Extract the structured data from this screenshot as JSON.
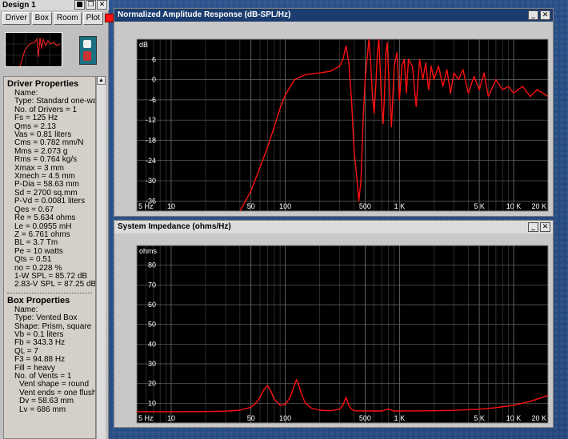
{
  "designer": {
    "title": "Design 1",
    "nav_buttons": [
      "Driver",
      "Box",
      "Room",
      "Plot"
    ],
    "window_controls": [
      "■",
      "❐",
      "✕"
    ]
  },
  "driver_properties": {
    "heading": "Driver Properties",
    "lines": [
      "Name:",
      "Type: Standard one-way c",
      "No. of Drivers = 1",
      "Fs = 125 Hz",
      "Qms = 2.13",
      "Vas = 0.81 liters",
      "Cms = 0.782 mm/N",
      "Mms = 2.073 g",
      "Rms = 0.764 kg/s",
      "Xmax = 3 mm",
      "Xmech = 4.5 mm",
      "P-Dia = 58.63 mm",
      "Sd = 2700 sq.mm",
      "P-Vd = 0.0081 liters",
      "Qes = 0.67",
      "Re = 5.634 ohms",
      "Le = 0.0955 mH",
      "Z = 6.761 ohms",
      "BL = 3.7 Tm",
      "Pe = 10 watts",
      "Qts = 0.51",
      "no = 0.228 %",
      "1-W SPL = 85.72 dB",
      "2.83-V SPL = 87.25 dB"
    ]
  },
  "box_properties": {
    "heading": "Box Properties",
    "lines": [
      "Name:",
      "Type: Vented Box",
      "Shape: Prism, square",
      "Vb = 0.1 liters",
      "Fb = 343.3 Hz",
      "QL = 7",
      "F3 = 94.88 Hz",
      "Fill = heavy",
      "No. of Vents = 1"
    ],
    "vent_lines": [
      "Vent shape = round",
      "Vent ends = one flush"
    ],
    "dim_lines": [
      "Dv = 58.63 mm",
      "Lv = 686 mm"
    ]
  },
  "amplitude_window": {
    "title": "Normalized Amplitude Response (dB-SPL/Hz)",
    "controls": [
      "_",
      "✕"
    ]
  },
  "impedance_window": {
    "title": "System Impedance (ohms/Hz)",
    "controls": [
      "_",
      "✕"
    ]
  },
  "chart_data": [
    {
      "type": "line",
      "title": "Normalized Amplitude Response (dB-SPL/Hz)",
      "xscale": "log",
      "xlim": [
        5,
        20000
      ],
      "ylim": [
        -39,
        12
      ],
      "yunit": "dB",
      "x_ticks": [
        {
          "value": 5,
          "label": "5 Hz"
        },
        {
          "value": 10,
          "label": "10"
        },
        {
          "value": 50,
          "label": "50"
        },
        {
          "value": 100,
          "label": "100"
        },
        {
          "value": 500,
          "label": "500"
        },
        {
          "value": 1000,
          "label": "1 K"
        },
        {
          "value": 5000,
          "label": "5 K"
        },
        {
          "value": 10000,
          "label": "10 K"
        },
        {
          "value": 20000,
          "label": "20 K"
        }
      ],
      "y_ticks": [
        6,
        0,
        -6,
        -12,
        -18,
        -24,
        -30,
        -36
      ],
      "grid": true,
      "series": [
        {
          "color": "#ff1010",
          "x": [
            40,
            50,
            60,
            70,
            80,
            90,
            100,
            120,
            150,
            200,
            250,
            300,
            320,
            340,
            360,
            380,
            400,
            420,
            440,
            460,
            480,
            500,
            520,
            540,
            560,
            580,
            600,
            620,
            640,
            660,
            680,
            700,
            720,
            740,
            760,
            780,
            800,
            850,
            900,
            950,
            1000,
            1050,
            1100,
            1150,
            1200,
            1300,
            1400,
            1500,
            1600,
            1700,
            1800,
            1900,
            2000,
            2200,
            2400,
            2600,
            2800,
            3000,
            3300,
            3600,
            4000,
            4500,
            5000,
            5500,
            6000,
            7000,
            8000,
            9000,
            10000,
            12000,
            14000,
            16000,
            18000,
            20000
          ],
          "y": [
            -39,
            -33,
            -26,
            -20,
            -14,
            -8.5,
            -4.5,
            0,
            1.5,
            2,
            2.5,
            4,
            6,
            10,
            5,
            -6,
            -21,
            -28,
            -36,
            -30,
            -12,
            0,
            6,
            12,
            5,
            -5,
            -10,
            -2,
            8,
            12,
            2,
            -8,
            -13,
            -4,
            8,
            11,
            3,
            -14,
            4,
            8,
            -6,
            4,
            6,
            -4,
            6,
            4,
            -8,
            6,
            0,
            5,
            -3,
            4,
            0,
            4,
            -2,
            3,
            -4,
            2,
            0,
            3,
            -4,
            1,
            -3,
            2,
            -5,
            0,
            -3,
            -2,
            -4,
            -2,
            -5,
            -3,
            -4,
            -5
          ]
        }
      ]
    },
    {
      "type": "line",
      "title": "System Impedance (ohms/Hz)",
      "xscale": "log",
      "xlim": [
        5,
        20000
      ],
      "ylim": [
        0,
        90
      ],
      "yunit": "ohms",
      "x_ticks": [
        {
          "value": 5,
          "label": "5 Hz"
        },
        {
          "value": 10,
          "label": "10"
        },
        {
          "value": 50,
          "label": "50"
        },
        {
          "value": 100,
          "label": "100"
        },
        {
          "value": 500,
          "label": "500"
        },
        {
          "value": 1000,
          "label": "1 K"
        },
        {
          "value": 5000,
          "label": "5 K"
        },
        {
          "value": 10000,
          "label": "10 K"
        },
        {
          "value": 20000,
          "label": "20 K"
        }
      ],
      "y_ticks": [
        80,
        70,
        60,
        50,
        40,
        30,
        20,
        10
      ],
      "grid": true,
      "series": [
        {
          "color": "#ff1010",
          "x": [
            5,
            10,
            20,
            30,
            40,
            50,
            55,
            60,
            65,
            70,
            75,
            80,
            90,
            100,
            110,
            120,
            125,
            130,
            140,
            150,
            170,
            200,
            250,
            300,
            320,
            340,
            360,
            380,
            400,
            500,
            600,
            700,
            800,
            900,
            1000,
            2000,
            3000,
            5000,
            7000,
            10000,
            14000,
            20000
          ],
          "y": [
            5.7,
            5.7,
            5.8,
            6,
            6.5,
            8,
            10,
            13,
            17,
            19,
            16,
            12,
            9,
            9.5,
            13,
            19,
            22,
            20,
            14,
            10,
            7.5,
            6.5,
            6.2,
            7,
            9,
            13,
            9,
            7,
            6.2,
            6.1,
            6.1,
            6.1,
            7,
            6.1,
            6.1,
            6.2,
            6.4,
            7,
            7.8,
            9,
            11,
            14
          ]
        }
      ]
    }
  ]
}
